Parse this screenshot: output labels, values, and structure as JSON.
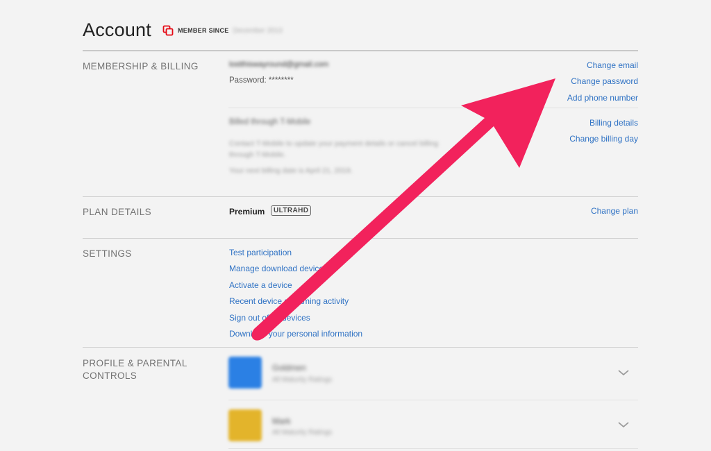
{
  "header": {
    "title": "Account",
    "member_since_label": "MEMBER SINCE",
    "member_since_value": "December 2013"
  },
  "membership": {
    "label": "MEMBERSHIP & BILLING",
    "email": "lostthiswayround@gmail.com",
    "password": "Password: ********",
    "billing_method": "Billed through T-Mobile",
    "billing_note_1": "Contact T-Mobile to update your payment details or cancel billing",
    "billing_note_2": "through T-Mobile.",
    "next_billing": "Your next billing date is April 21, 2019.",
    "links": {
      "change_email": "Change email",
      "change_password": "Change password",
      "add_phone": "Add phone number",
      "billing_details": "Billing details",
      "change_billing_day": "Change billing day"
    }
  },
  "plan": {
    "label": "PLAN DETAILS",
    "name": "Premium",
    "badge_ultra": "ULTRA",
    "badge_hd": "HD",
    "change_plan": "Change plan"
  },
  "settings": {
    "label": "SETTINGS",
    "items": [
      "Test participation",
      "Manage download devices",
      "Activate a device",
      "Recent device streaming activity",
      "Sign out of all devices",
      "Download your personal information"
    ]
  },
  "profiles": {
    "label_line1": "PROFILE & PARENTAL",
    "label_line2": "CONTROLS",
    "items": [
      {
        "name": "Goldmen",
        "sub": "All Maturity Ratings",
        "color": "#2b80e4"
      },
      {
        "name": "Mark",
        "sub": "All Maturity Ratings",
        "color": "#e3b42b"
      }
    ]
  },
  "colors": {
    "link": "#2f72c4",
    "arrow": "#f2225c",
    "brand_red": "#e50914"
  }
}
